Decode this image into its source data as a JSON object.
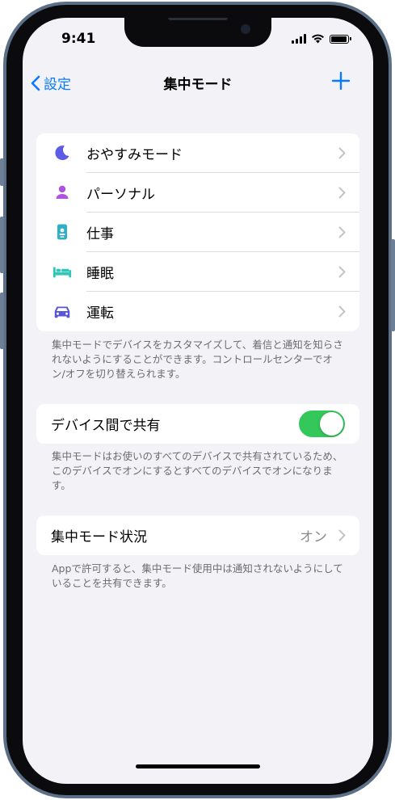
{
  "status_bar": {
    "time": "9:41"
  },
  "nav": {
    "back_label": "設定",
    "title": "集中モード"
  },
  "focus_modes": {
    "items": [
      {
        "label": "おやすみモード",
        "icon": "moon-icon",
        "color": "#5e5ce6"
      },
      {
        "label": "パーソナル",
        "icon": "person-icon",
        "color": "#af52de"
      },
      {
        "label": "仕事",
        "icon": "id-badge-icon",
        "color": "#30b0c7"
      },
      {
        "label": "睡眠",
        "icon": "bed-icon",
        "color": "#32c5b8"
      },
      {
        "label": "運転",
        "icon": "car-icon",
        "color": "#5856d6"
      }
    ],
    "footnote": "集中モードでデバイスをカスタマイズして、着信と通知を知らされないようにすることができます。コントロールセンターでオン/オフを切り替えられます。"
  },
  "share_across_devices": {
    "label": "デバイス間で共有",
    "enabled": true,
    "footnote": "集中モードはお使いのすべてのデバイスで共有されているため、このデバイスでオンにするとすべてのデバイスでオンになります。"
  },
  "focus_status": {
    "label": "集中モード状況",
    "value": "オン",
    "footnote": "Appで許可すると、集中モード使用中は通知されないようにしていることを共有できます。"
  },
  "colors": {
    "accent": "#0a7aff",
    "toggle_on": "#34c759",
    "background": "#f2f2f7"
  }
}
